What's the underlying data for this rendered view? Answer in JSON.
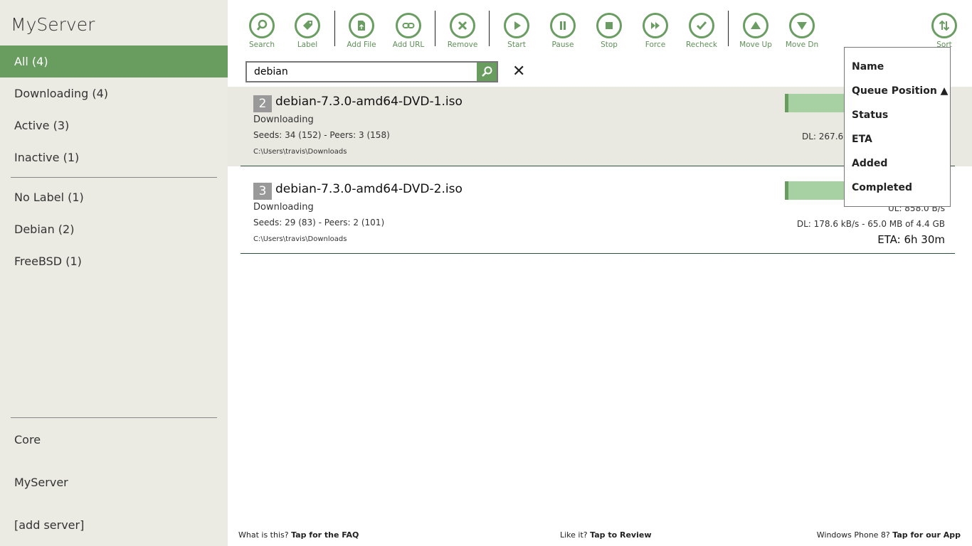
{
  "app_title": "MyServer",
  "accent_color": "#699d60",
  "sidebar": {
    "filters": [
      {
        "label": "All (4)",
        "selected": true
      },
      {
        "label": "Downloading (4)"
      },
      {
        "label": "Active (3)"
      },
      {
        "label": "Inactive (1)"
      }
    ],
    "labels": [
      {
        "label": "No Label (1)"
      },
      {
        "label": "Debian (2)"
      },
      {
        "label": "FreeBSD (1)"
      }
    ],
    "servers": [
      {
        "label": "Core"
      },
      {
        "label": "MyServer"
      },
      {
        "label": "[add server]"
      }
    ]
  },
  "toolbar": [
    {
      "label": "Search",
      "icon": "search-icon"
    },
    {
      "label": "Label",
      "icon": "tag-icon"
    },
    {
      "label": "Add File",
      "icon": "add-file-icon"
    },
    {
      "label": "Add URL",
      "icon": "link-icon"
    },
    {
      "label": "Remove",
      "icon": "close-icon"
    },
    {
      "label": "Start",
      "icon": "play-icon"
    },
    {
      "label": "Pause",
      "icon": "pause-icon"
    },
    {
      "label": "Stop",
      "icon": "stop-icon"
    },
    {
      "label": "Force",
      "icon": "fast-forward-icon"
    },
    {
      "label": "Recheck",
      "icon": "check-icon"
    },
    {
      "label": "Move Up",
      "icon": "triangle-up-icon"
    },
    {
      "label": "Move Dn",
      "icon": "triangle-down-icon"
    },
    {
      "label": "Sort",
      "icon": "sort-icon"
    }
  ],
  "search": {
    "value": "debian"
  },
  "torrents": [
    {
      "queue": "2",
      "name": "debian-7.3.0-amd64-DVD-1.iso",
      "status": "Downloading",
      "seeds": "Seeds: 34 (152) - Peers: 3 (158)",
      "path": "C:\\Users\\travis\\Downloads",
      "progress_percent": 2,
      "dl": "DL: 267.6",
      "selected": true
    },
    {
      "queue": "3",
      "name": "debian-7.3.0-amd64-DVD-2.iso",
      "status": "Downloading",
      "seeds": "Seeds: 29 (83) - Peers: 2 (101)",
      "path": "C:\\Users\\travis\\Downloads",
      "progress_percent": 2,
      "ul": "UL: 858.0 B/s",
      "dl": "DL: 178.6 kB/s - 65.0 MB of 4.4 GB",
      "eta": "ETA: 6h 30m"
    }
  ],
  "sort_menu": {
    "items": [
      "Name",
      "Queue Position  ▲",
      "Status",
      "ETA",
      "Added",
      "Completed"
    ],
    "active": "Queue Position",
    "direction": "ascending"
  },
  "footer": {
    "faq_prefix": "What is this?",
    "faq_link": "Tap for the FAQ",
    "review_prefix": "Like it?",
    "review_link": "Tap to Review",
    "app_prefix": "Windows Phone 8?",
    "app_link": "Tap for our App"
  }
}
